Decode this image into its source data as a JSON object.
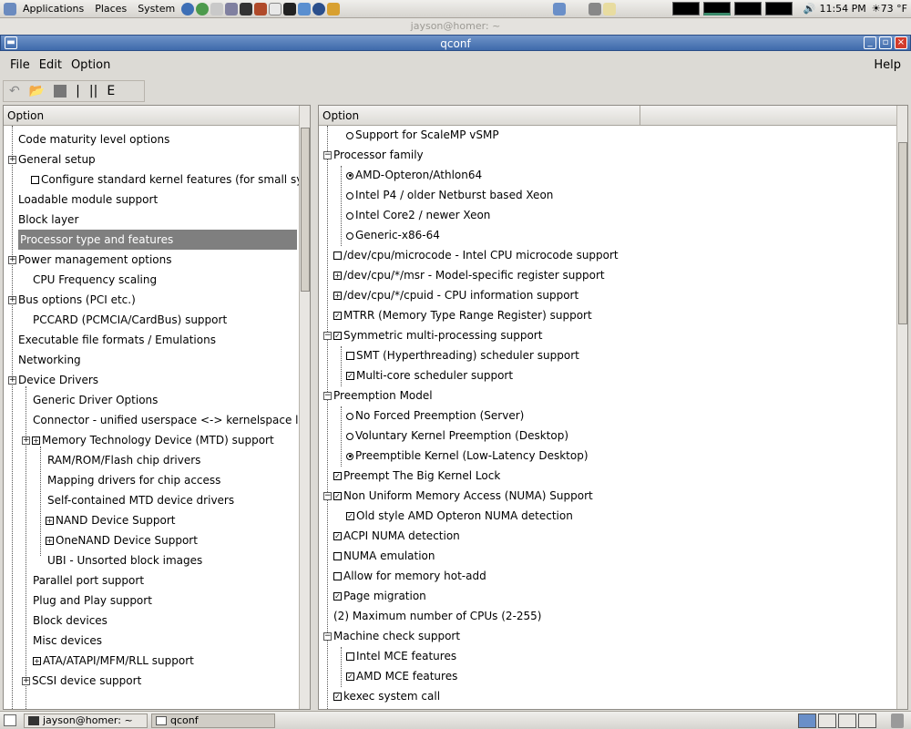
{
  "top_panel": {
    "menus": [
      "Applications",
      "Places",
      "System"
    ],
    "clock": "11:54 PM",
    "weather": "73 °F"
  },
  "background_window_title": "jayson@homer: ~",
  "window": {
    "title": "qconf"
  },
  "menubar": {
    "file": "File",
    "edit": "Edit",
    "option": "Option",
    "help": "Help"
  },
  "left_pane": {
    "header": "Option",
    "items": [
      {
        "label": "Code maturity level options"
      },
      {
        "label": "General setup"
      },
      {
        "label": "Configure standard kernel features (for small sy"
      },
      {
        "label": "Loadable module support"
      },
      {
        "label": "Block layer"
      },
      {
        "label": "Processor type and features"
      },
      {
        "label": "Power management options"
      },
      {
        "label": "CPU Frequency scaling"
      },
      {
        "label": "Bus options (PCI etc.)"
      },
      {
        "label": "PCCARD (PCMCIA/CardBus) support"
      },
      {
        "label": "Executable file formats / Emulations"
      },
      {
        "label": "Networking"
      },
      {
        "label": "Device Drivers"
      },
      {
        "label": "Generic Driver Options"
      },
      {
        "label": "Connector - unified userspace <-> kernelspace lir"
      },
      {
        "label": "Memory Technology Device (MTD) support"
      },
      {
        "label": "RAM/ROM/Flash chip drivers"
      },
      {
        "label": "Mapping drivers for chip access"
      },
      {
        "label": "Self-contained MTD device drivers"
      },
      {
        "label": "NAND Device Support"
      },
      {
        "label": "OneNAND Device Support"
      },
      {
        "label": "UBI - Unsorted block images"
      },
      {
        "label": "Parallel port support"
      },
      {
        "label": "Plug and Play support"
      },
      {
        "label": "Block devices"
      },
      {
        "label": "Misc devices"
      },
      {
        "label": "ATA/ATAPI/MFM/RLL support"
      },
      {
        "label": "SCSI device support"
      }
    ]
  },
  "right_pane": {
    "header": "Option",
    "items": [
      {
        "label": "Support for ScaleMP vSMP"
      },
      {
        "label": "Processor family"
      },
      {
        "label": "AMD-Opteron/Athlon64"
      },
      {
        "label": "Intel P4 / older Netburst based Xeon"
      },
      {
        "label": "Intel Core2 / newer Xeon"
      },
      {
        "label": "Generic-x86-64"
      },
      {
        "label": "/dev/cpu/microcode - Intel CPU microcode support"
      },
      {
        "label": "/dev/cpu/*/msr - Model-specific register support"
      },
      {
        "label": "/dev/cpu/*/cpuid - CPU information support"
      },
      {
        "label": "MTRR (Memory Type Range Register) support"
      },
      {
        "label": "Symmetric multi-processing support"
      },
      {
        "label": "SMT (Hyperthreading) scheduler support"
      },
      {
        "label": "Multi-core scheduler support"
      },
      {
        "label": "Preemption Model"
      },
      {
        "label": "No Forced Preemption (Server)"
      },
      {
        "label": "Voluntary Kernel Preemption (Desktop)"
      },
      {
        "label": "Preemptible Kernel (Low-Latency Desktop)"
      },
      {
        "label": "Preempt The Big Kernel Lock"
      },
      {
        "label": "Non Uniform Memory Access (NUMA) Support"
      },
      {
        "label": "Old style AMD Opteron NUMA detection"
      },
      {
        "label": "ACPI NUMA detection"
      },
      {
        "label": "NUMA emulation"
      },
      {
        "label": "Allow for memory hot-add"
      },
      {
        "label": "Page migration"
      },
      {
        "label": "(2) Maximum number of CPUs (2-255)"
      },
      {
        "label": "Machine check support"
      },
      {
        "label": "Intel MCE features"
      },
      {
        "label": "AMD MCE features"
      },
      {
        "label": "kexec system call"
      }
    ]
  },
  "taskbar": {
    "tasks": [
      "jayson@homer: ~",
      "qconf"
    ]
  }
}
